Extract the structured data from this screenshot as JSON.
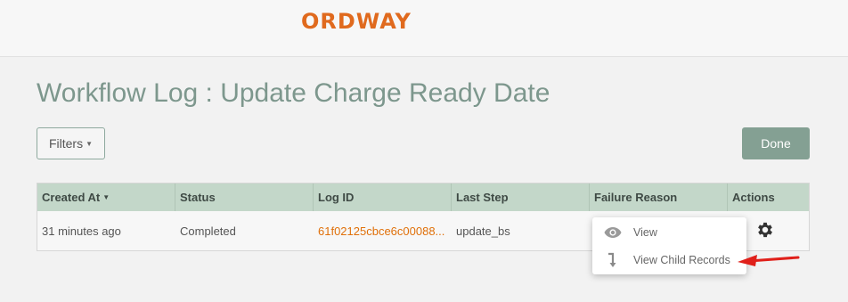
{
  "header": {
    "logo_text": "ORDWAY",
    "brand_color": "#e06a1e"
  },
  "page": {
    "title": "Workflow Log : Update Charge Ready Date"
  },
  "toolbar": {
    "filters_label": "Filters",
    "done_label": "Done"
  },
  "table": {
    "columns": [
      "Created At",
      "Status",
      "Log ID",
      "Last Step",
      "Failure Reason",
      "Actions"
    ],
    "sorted_column": "Created At",
    "rows": [
      {
        "created_at": "31 minutes ago",
        "status": "Completed",
        "log_id": "61f02125cbce6c00088...",
        "last_step": "update_bs",
        "failure_reason": ""
      }
    ]
  },
  "actions_menu": {
    "items": [
      {
        "label": "View",
        "icon": "eye-icon"
      },
      {
        "label": "View Child Records",
        "icon": "child-arrow-icon"
      }
    ]
  },
  "colors": {
    "header_row": "#c3d7c9",
    "accent": "#84a093",
    "link": "#e0700a",
    "annotation_arrow": "#e0201a"
  }
}
